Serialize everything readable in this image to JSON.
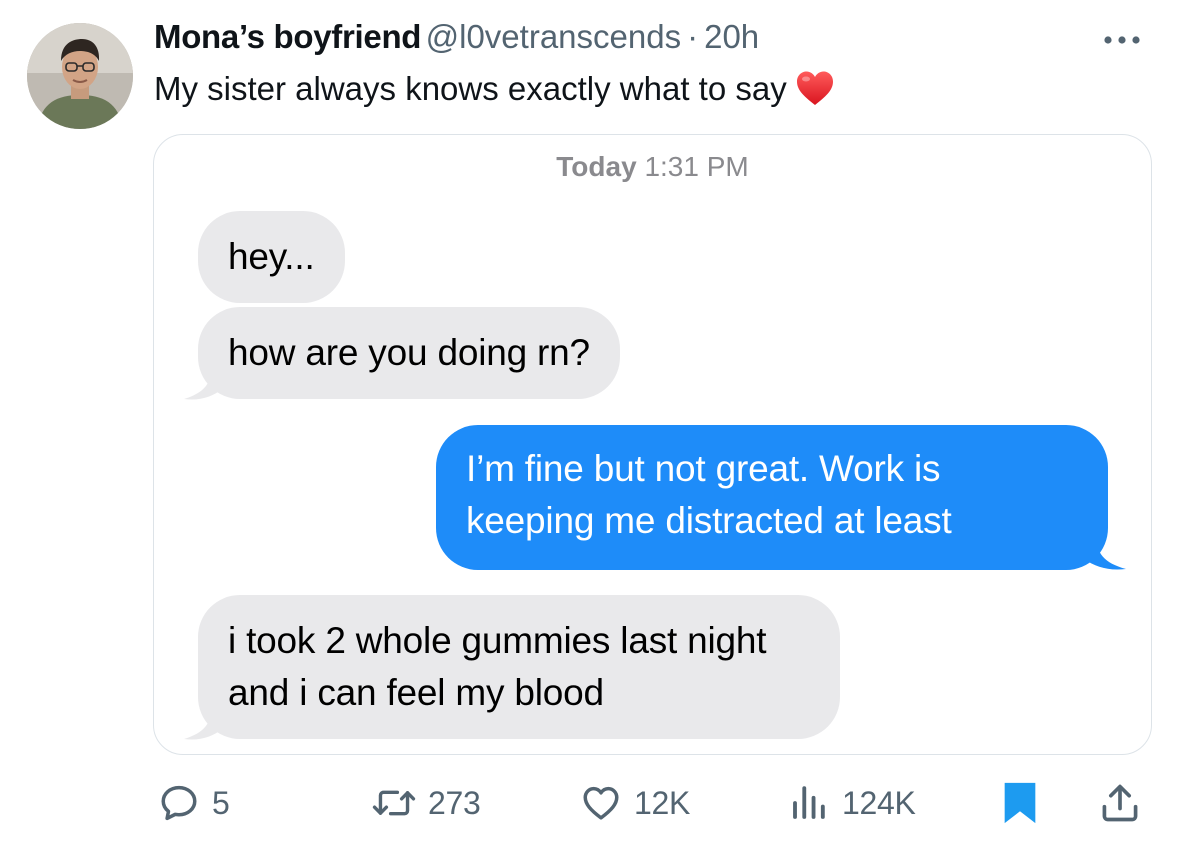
{
  "tweet": {
    "author_name": "Mona’s boyfriend",
    "handle": "@l0vetranscends",
    "separator": "·",
    "time": "20h",
    "text": "My sister always knows exactly what to say",
    "emoji": "heart-emoji"
  },
  "screenshot": {
    "timestamp_day": "Today",
    "timestamp_time": "1:31 PM",
    "messages": [
      {
        "direction": "received",
        "text": "hey..."
      },
      {
        "direction": "received",
        "text": "how are you doing rn?"
      },
      {
        "direction": "sent",
        "text": "I’m fine but not great. Work is keeping me distracted at least"
      },
      {
        "direction": "received",
        "text": "i took 2 whole gummies last night and i can feel my blood"
      }
    ],
    "colors": {
      "received_bubble": "#e9e9eb",
      "sent_bubble": "#1e8cf9"
    }
  },
  "actions": {
    "replies": "5",
    "reposts": "273",
    "likes": "12K",
    "views": "124K"
  },
  "colors": {
    "accent": "#1d9bf0",
    "muted": "#536471"
  }
}
